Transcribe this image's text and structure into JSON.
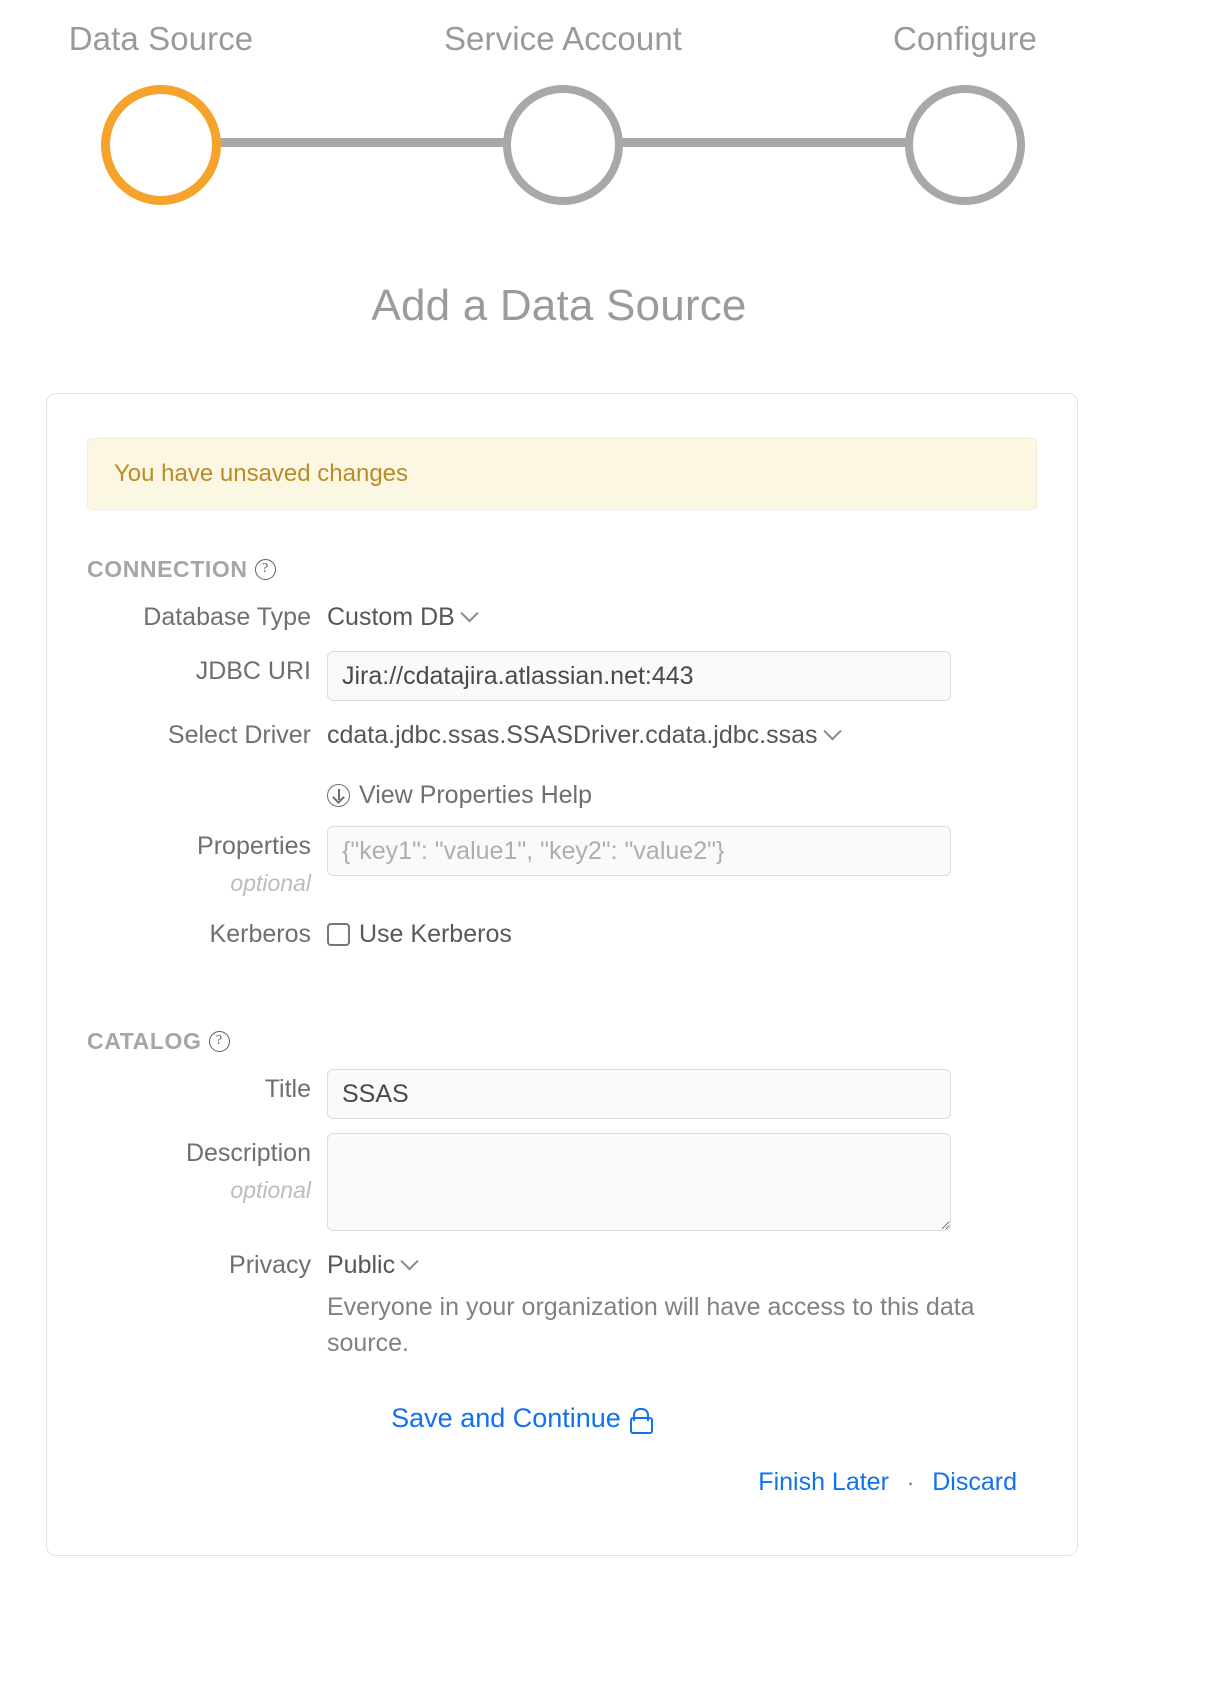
{
  "stepper": {
    "steps": [
      {
        "label": "Data Source",
        "state": "active"
      },
      {
        "label": "Service Account",
        "state": "inactive"
      },
      {
        "label": "Configure",
        "state": "inactive"
      }
    ],
    "active_color": "#f5a32a",
    "inactive_color": "#a8a8a8"
  },
  "page": {
    "title": "Add a Data Source"
  },
  "banner": {
    "text": "You have unsaved changes",
    "text_color": "#b98c28",
    "background": "#fbf7e3"
  },
  "connection": {
    "section_label": "CONNECTION",
    "help_icon": "question-circle-icon",
    "database_type": {
      "label": "Database Type",
      "value": "Custom DB"
    },
    "jdbc_uri": {
      "label": "JDBC URI",
      "value": "Jira://cdatajira.atlassian.net:443",
      "placeholder": ""
    },
    "select_driver": {
      "label": "Select Driver",
      "value": "cdata.jdbc.ssas.SSASDriver.cdata.jdbc.ssas"
    },
    "properties_help": {
      "label": "View Properties Help",
      "icon": "download-circle-icon"
    },
    "properties": {
      "label": "Properties",
      "sublabel": "optional",
      "value": "",
      "placeholder": "{\"key1\": \"value1\", \"key2\": \"value2\"}"
    },
    "kerberos": {
      "label": "Kerberos",
      "checkbox_label": "Use Kerberos",
      "checked": false
    }
  },
  "catalog": {
    "section_label": "CATALOG",
    "help_icon": "question-circle-icon",
    "title": {
      "label": "Title",
      "value": "SSAS",
      "placeholder": ""
    },
    "description": {
      "label": "Description",
      "sublabel": "optional",
      "value": "",
      "placeholder": ""
    },
    "privacy": {
      "label": "Privacy",
      "value": "Public",
      "description": "Everyone in your organization will have access to this data source."
    }
  },
  "actions": {
    "save_and_continue": "Save and Continue",
    "save_icon": "lock-icon",
    "finish_later": "Finish Later",
    "separator": "·",
    "discard": "Discard",
    "link_color": "#1271f0"
  }
}
